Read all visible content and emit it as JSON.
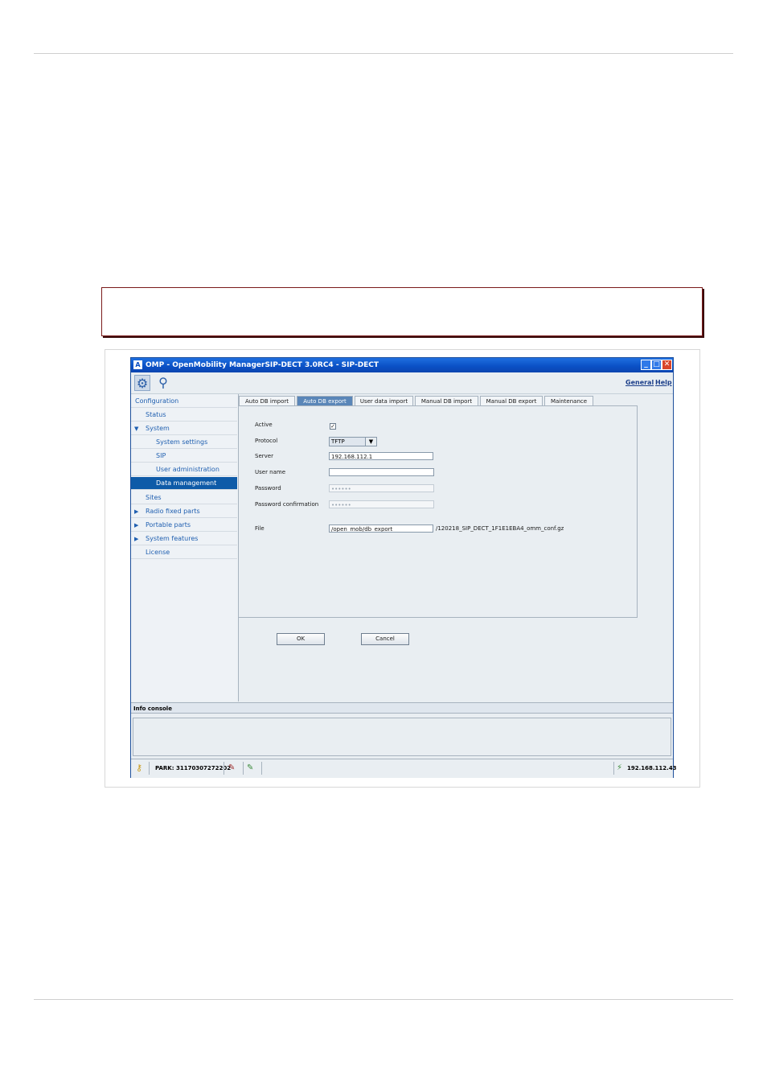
{
  "window": {
    "title": "OMP - OpenMobility ManagerSIP-DECT 3.0RC4 - SIP-DECT",
    "min_glyph": "_",
    "max_glyph": "□",
    "close_glyph": "✕"
  },
  "toolbar": {
    "general_label": "General",
    "help_label": "Help"
  },
  "sidebar": {
    "items": [
      {
        "label": "Configuration",
        "arrow": ""
      },
      {
        "label": "Status",
        "arrow": ""
      },
      {
        "label": "System",
        "arrow": "▼"
      },
      {
        "label": "System settings",
        "arrow": ""
      },
      {
        "label": "SIP",
        "arrow": ""
      },
      {
        "label": "User administration",
        "arrow": ""
      },
      {
        "label": "Data management",
        "arrow": ""
      },
      {
        "label": "Sites",
        "arrow": ""
      },
      {
        "label": "Radio fixed parts",
        "arrow": "▶"
      },
      {
        "label": "Portable parts",
        "arrow": "▶"
      },
      {
        "label": "System features",
        "arrow": "▶"
      },
      {
        "label": "License",
        "arrow": ""
      }
    ]
  },
  "tabs": [
    {
      "label": "Auto DB import"
    },
    {
      "label": "Auto DB export"
    },
    {
      "label": "User data import"
    },
    {
      "label": "Manual DB import"
    },
    {
      "label": "Manual DB export"
    },
    {
      "label": "Maintenance"
    }
  ],
  "form": {
    "active_label": "Active",
    "active_mark": "✓",
    "protocol_label": "Protocol",
    "protocol_value": "TFTP",
    "server_label": "Server",
    "server_value": "192.168.112.1",
    "username_label": "User name",
    "username_value": "",
    "password_label": "Password",
    "password_value": "••••••",
    "password_confirm_label": "Password confirmation",
    "password_confirm_value": "••••••",
    "file_label": "File",
    "file_value": "/open_mob/db_export",
    "file_suffix": "/120218_SIP_DECT_1F1E1EBA4_omm_conf.gz"
  },
  "buttons": {
    "ok_label": "OK",
    "cancel_label": "Cancel"
  },
  "console": {
    "header": "Info console"
  },
  "statusbar": {
    "park_label": "PARK: 31170307272202",
    "ip_label": "192.168.112.43"
  }
}
